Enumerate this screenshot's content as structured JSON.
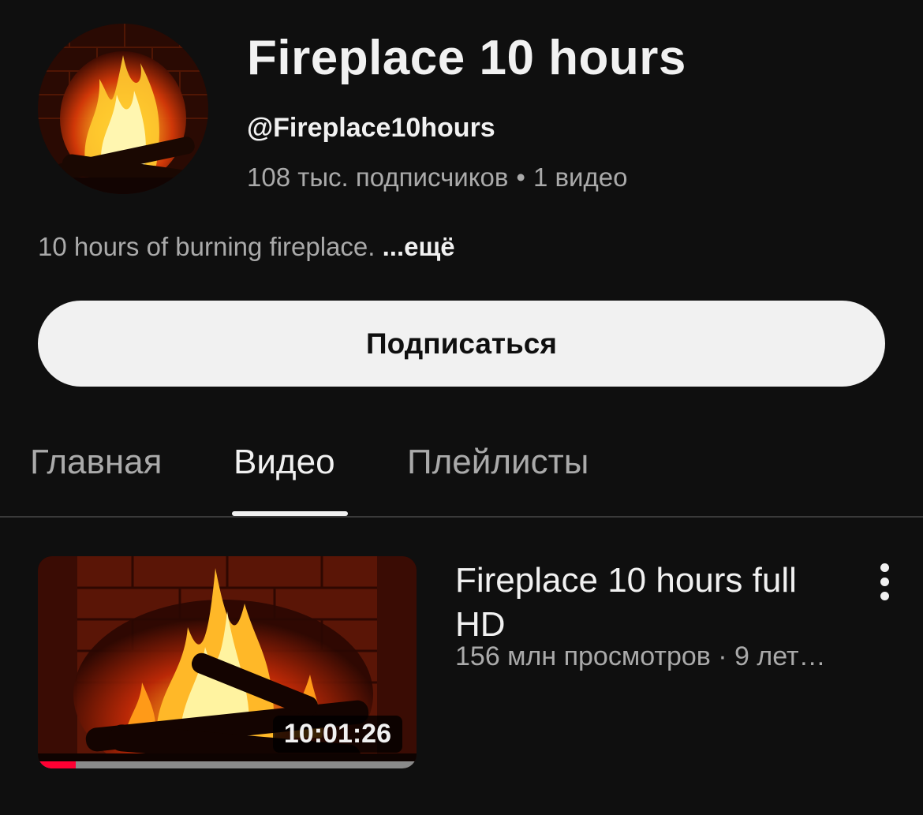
{
  "channel": {
    "title": "Fireplace 10 hours",
    "handle": "@Fireplace10hours",
    "subscribers": "108 тыс. подписчиков",
    "separator": "•",
    "video_count": "1 видео",
    "description": "10 hours of burning fireplace.",
    "more_label": "...ещё",
    "avatar_icon": "fireplace-avatar-image"
  },
  "subscribe_button": {
    "label": "Подписаться"
  },
  "tabs": [
    {
      "label": "Главная",
      "active": false
    },
    {
      "label": "Видео",
      "active": true
    },
    {
      "label": "Плейлисты",
      "active": false
    }
  ],
  "videos": [
    {
      "title": "Fireplace 10 hours full HD",
      "meta": "156 млн просмотров · 9 лет…",
      "duration": "10:01:26",
      "watch_progress": 0.1,
      "menu_icon": "more-vertical-icon"
    }
  ],
  "colors": {
    "background": "#0f0f0f",
    "primary_text": "#f1f1f1",
    "secondary_text": "#aaaaaa",
    "progress": "#ff0033"
  }
}
